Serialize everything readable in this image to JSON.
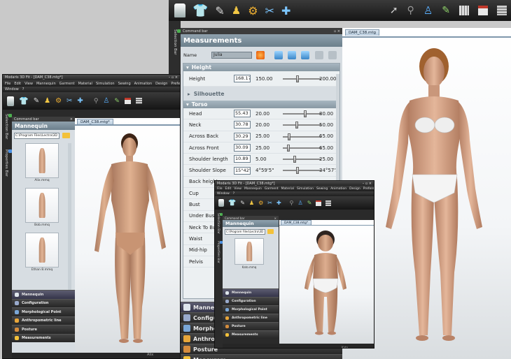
{
  "main_toolbar": {
    "icons_left": [
      "mannequin-tool-icon",
      "shirt-tool-icon",
      "ruler-tool-icon",
      "pin-tool-icon",
      "gear-shirt-tool-icon",
      "scissors-shirt-tool-icon",
      "shirt-sewing-tool-icon"
    ],
    "icons_right": [
      "arrow-tool-icon",
      "lock-tool-icon",
      "figure-tool-icon",
      "paint-tool-icon",
      "grid-tool-icon",
      "render-tool-icon",
      "list-tool-icon"
    ]
  },
  "right_window": {
    "side_tab": "Selection Bar",
    "doc_tab": "DAM_C38.mtg"
  },
  "measurements": {
    "cmd_bar": "Command bar",
    "title": "Measurements",
    "name_label": "Name",
    "name_value": "Julia",
    "height_section": "Height",
    "height_row": {
      "label": "Height",
      "value": "168.17",
      "min": "150.00",
      "max": "200.00"
    },
    "silhouette_section": "Silhouette",
    "torso_section": "Torso",
    "rows": [
      {
        "label": "Head",
        "value": "55.43",
        "min": "20.00",
        "max": "80.00"
      },
      {
        "label": "Neck",
        "value": "30.78",
        "min": "20.00",
        "max": "50.00"
      },
      {
        "label": "Across Back",
        "value": "30.29",
        "min": "25.00",
        "max": "65.00"
      },
      {
        "label": "Across Front",
        "value": "30.09",
        "min": "25.00",
        "max": "65.00"
      },
      {
        "label": "Shoulder length",
        "value": "10.89",
        "min": "5.00",
        "max": "25.00"
      },
      {
        "label": "Shoulder Slope",
        "value": "15°42'",
        "min": "4°59'5\"",
        "max": "34°57'2\""
      },
      {
        "label": "Back height",
        "value": "",
        "min": "",
        "max": ""
      },
      {
        "label": "Cup",
        "value": "",
        "min": "",
        "max": ""
      },
      {
        "label": "Bust",
        "value": "",
        "min": "",
        "max": ""
      },
      {
        "label": "Under Bust",
        "value": "",
        "min": "",
        "max": ""
      },
      {
        "label": "Neck To Bust",
        "value": "",
        "min": "",
        "max": ""
      },
      {
        "label": "Waist",
        "value": "",
        "min": "",
        "max": ""
      },
      {
        "label": "Mid-hip",
        "value": "",
        "min": "",
        "max": ""
      },
      {
        "label": "Pelvis",
        "value": "",
        "min": "",
        "max": ""
      }
    ],
    "bottom_nav": [
      "Mannequ",
      "Configura",
      "Morpholo",
      "Anthropo",
      "Posture",
      "Measurem"
    ]
  },
  "left_window": {
    "title": "Modaris 3D Fit - [DAM_C38.mtg*]",
    "menu": [
      "File",
      "Edit",
      "View",
      "Mannequin",
      "Garment",
      "Material",
      "Simulation",
      "Sewing",
      "Animation",
      "Design",
      "Preferences"
    ],
    "menu2": [
      "Window",
      "?"
    ],
    "cmd_bar": "Command bar",
    "panel_title": "Mannequin",
    "path": "C:\\Program Files\\Lectra\\3D",
    "side_tabs": [
      "Selection Bar",
      "Properties Bar"
    ],
    "thumbs": [
      "Alix.mmq",
      "Bob.mmq",
      "Ethan 8.mmq"
    ],
    "doc_tab": "DAM_C38.mtg*",
    "nav": [
      "Mannequin",
      "Configuration",
      "Morphological Point",
      "Anthropometric line",
      "Posture",
      "Measurements"
    ],
    "status": "Alix"
  },
  "child_window": {
    "title": "Modaris 3D Fit - [DAM_C38.mtg*]",
    "menu": [
      "File",
      "Edit",
      "View",
      "Mannequin",
      "Garment",
      "Material",
      "Simulation",
      "Sewing",
      "Animation",
      "Design",
      "Preferences"
    ],
    "menu2": [
      "Window",
      "?"
    ],
    "cmd_bar": "Command bar",
    "panel_title": "Mannequin",
    "path": "C:\\Program Files\\Lectra\\3D",
    "side_tabs": [
      "Selection Bar",
      "Properties Bar"
    ],
    "thumbs": [
      "Kato.mmq"
    ],
    "doc_tab": "DAM_C38.mtg*",
    "nav": [
      "Mannequin",
      "Configuration",
      "Morphological Point",
      "Anthropometric line",
      "Posture",
      "Measurements"
    ],
    "status": "Kato"
  },
  "colors": {
    "toolbar": "#1c1c1c",
    "panel_header": "#7f919d",
    "skin": "#d9a98a",
    "underwear": "#f2f2f2"
  }
}
